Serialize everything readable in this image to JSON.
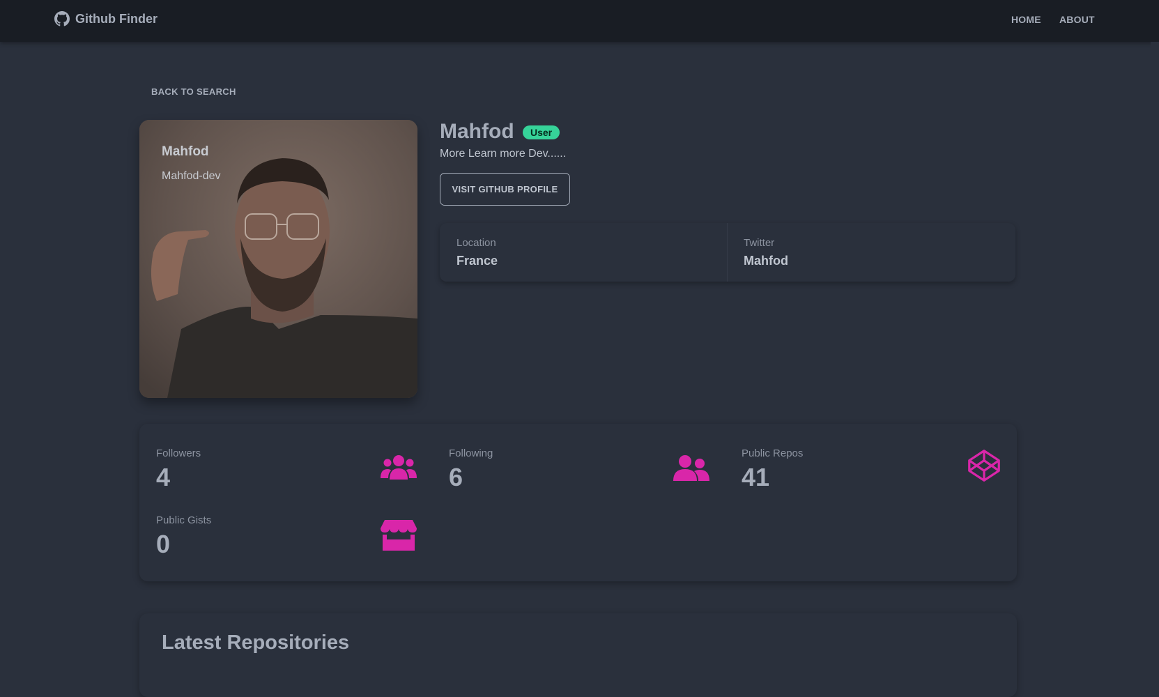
{
  "navbar": {
    "brand_title": "Github Finder",
    "brand_icon": "github-icon",
    "links": [
      "HOME",
      "ABOUT"
    ]
  },
  "back_link": "BACK TO SEARCH",
  "avatar": {
    "name": "Mahfod",
    "login": "Mahfod-dev"
  },
  "profile": {
    "name": "Mahfod",
    "badge": "User",
    "bio": "More Learn more Dev......",
    "visit_button": "VISIT GITHUB PROFILE"
  },
  "info": {
    "location_label": "Location",
    "location_value": "France",
    "twitter_label": "Twitter",
    "twitter_value": "Mahfod"
  },
  "stats": [
    {
      "title": "Followers",
      "value": "4",
      "icon": "users-group-icon"
    },
    {
      "title": "Following",
      "value": "6",
      "icon": "user-friends-icon"
    },
    {
      "title": "Public Repos",
      "value": "41",
      "icon": "codepen-icon"
    },
    {
      "title": "Public Gists",
      "value": "0",
      "icon": "store-icon"
    }
  ],
  "repos": {
    "title": "Latest Repositories"
  },
  "colors": {
    "background": "#2a303c",
    "navbar": "#191d24",
    "accent_icon": "#d926a9",
    "badge": "#36d399"
  }
}
